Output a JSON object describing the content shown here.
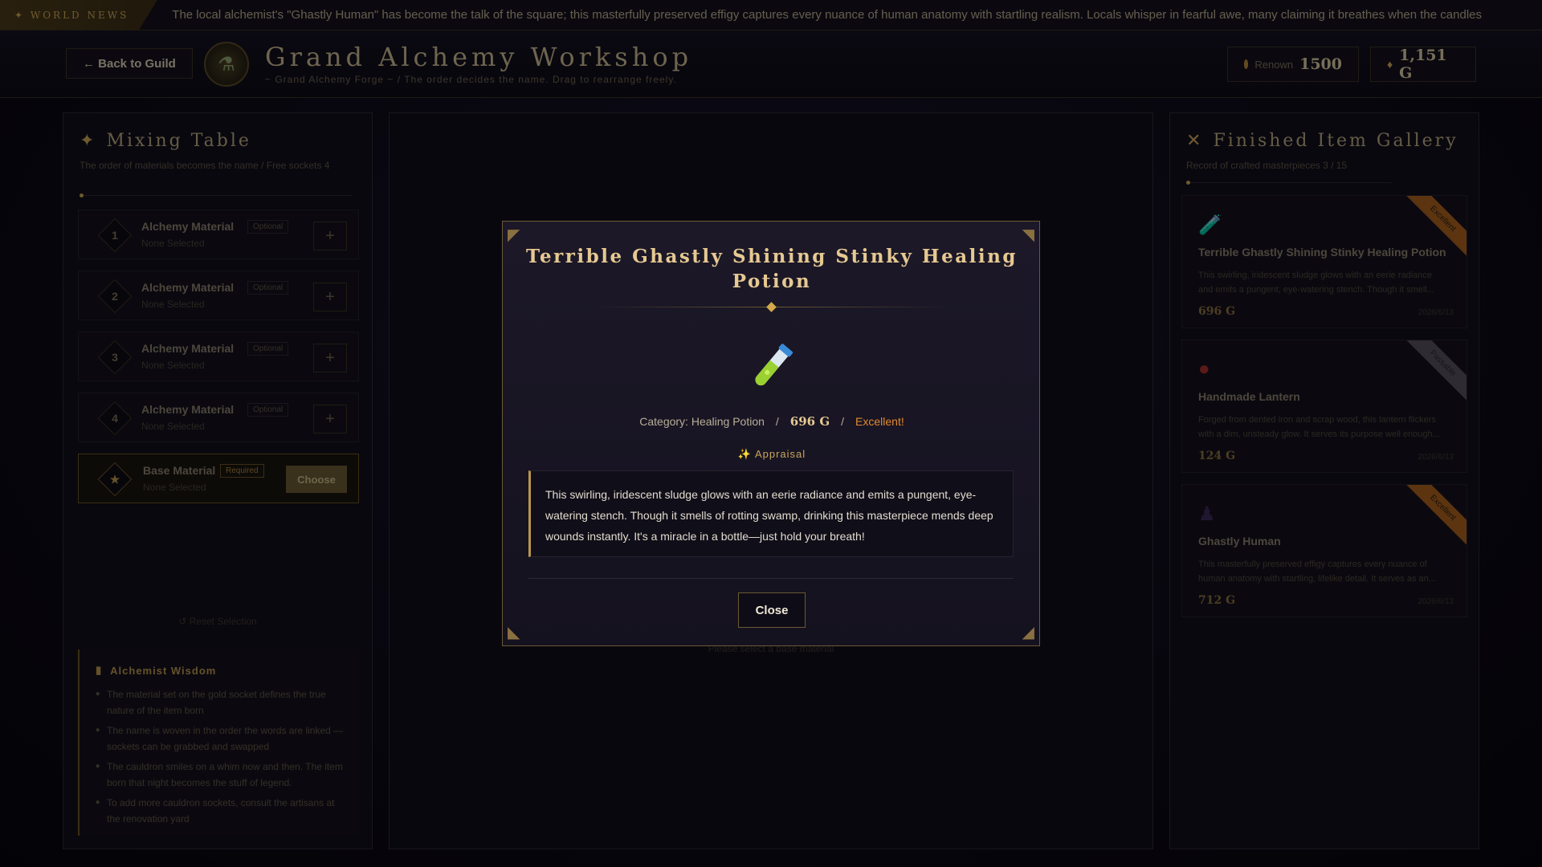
{
  "ticker": {
    "label": "✦ WORLD NEWS",
    "text": "The local alchemist's \"Ghastly Human\" has become the talk of the square; this masterfully preserved effigy captures every nuance of human anatomy with startling realism. Locals whisper in fearful awe, many claiming it breathes when the candles"
  },
  "header": {
    "back_label": "← Back to Guild",
    "title": "Grand Alchemy Workshop",
    "subtitle": "~ Grand Alchemy Forge ~ / The order decides the name. Drag to rearrange freely.",
    "renown_label": "Renown",
    "renown_value": "1500",
    "gold_value": "1,151 G"
  },
  "mixing_table": {
    "title": "Mixing Table",
    "subtitle": "The order of materials becomes the name / Free sockets 4",
    "sockets": [
      {
        "num": "1",
        "name": "Alchemy Material",
        "tag": "Optional",
        "selection": "None Selected"
      },
      {
        "num": "2",
        "name": "Alchemy Material",
        "tag": "Optional",
        "selection": "None Selected"
      },
      {
        "num": "3",
        "name": "Alchemy Material",
        "tag": "Optional",
        "selection": "None Selected"
      },
      {
        "num": "4",
        "name": "Alchemy Material",
        "tag": "Optional",
        "selection": "None Selected"
      }
    ],
    "base": {
      "name": "Base Material",
      "tag": "Required",
      "selection": "None Selected",
      "button": "Choose"
    },
    "reset_label": "↺ Reset Selection",
    "wisdom": {
      "title": "Alchemist Wisdom",
      "tips": [
        "The material set on the gold socket defines the true nature of the item born",
        "The name is woven in the order the words are linked — sockets can be grabbed and swapped",
        "The cauldron smiles on a whim now and then. The item born that night becomes the stuff of legend.",
        "To add more cauldron sockets, consult the artisans at the renovation yard"
      ]
    }
  },
  "center": {
    "hint": "Please select a base material"
  },
  "gallery": {
    "title": "Finished Item Gallery",
    "subtitle": "Record of crafted masterpieces 3 / 15",
    "items": [
      {
        "name": "Terrible Ghastly Shining Stinky Healing Potion",
        "desc": "This swirling, iridescent sludge glows with an eerie radiance and emits a pungent, eye-watering stench. Though it smell...",
        "price": "696 G",
        "date": "2026/6/13",
        "ribbon": "Excellent",
        "icon": "potion-icon"
      },
      {
        "name": "Handmade Lantern",
        "desc": "Forged from dented iron and scrap wood, this lantern flickers with a dim, unsteady glow. It serves its purpose well enough...",
        "price": "124 G",
        "date": "2026/6/13",
        "ribbon": "Passable",
        "icon": "lantern-icon"
      },
      {
        "name": "Ghastly Human",
        "desc": "This masterfully preserved effigy captures every nuance of human anatomy with startling, lifelike detail. It serves as an...",
        "price": "712 G",
        "date": "2026/6/13",
        "ribbon": "Excellent",
        "icon": "human-icon"
      }
    ]
  },
  "modal": {
    "title": "Terrible Ghastly Shining Stinky Healing Potion",
    "category": "Category: Healing Potion",
    "sep": "/",
    "price": "696 G",
    "grade": "Excellent!",
    "appraisal_label": "✨ Appraisal",
    "appraisal_text": "This swirling, iridescent sludge glows with an eerie radiance and emits a pungent, eye-watering stench. Though it smells of rotting swamp, drinking this masterpiece mends deep wounds instantly. It's a miracle in a bottle—just hold your breath!",
    "close_label": "Close"
  },
  "colors": {
    "accent": "#c9a55a",
    "excellent": "#e08a2e",
    "modal_title": "#e6c992"
  }
}
